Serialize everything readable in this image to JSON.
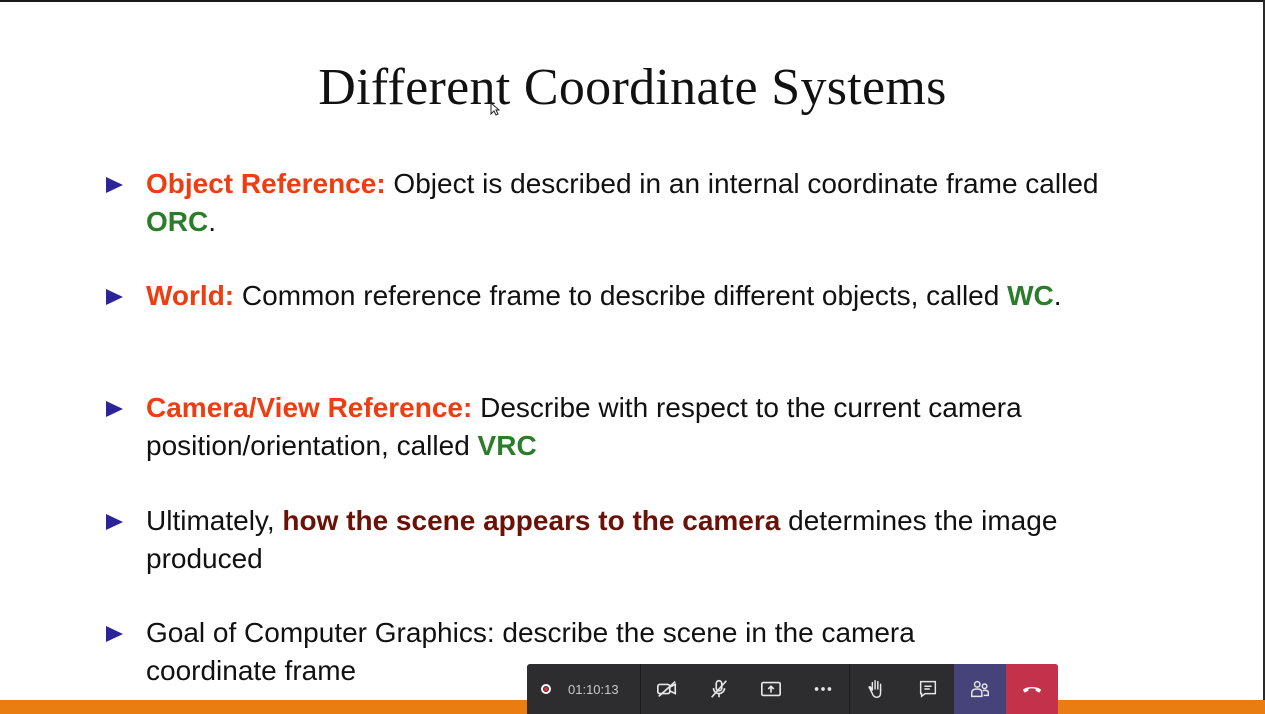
{
  "slide": {
    "title": "Different Coordinate Systems",
    "bullets": [
      {
        "keyword": "Object Reference:",
        "text": " Object is described in an internal coordinate frame called ",
        "acronym": "ORC",
        "tail": "."
      },
      {
        "keyword": "World:",
        "text": " Common reference frame to describe different objects, called ",
        "acronym": "WC",
        "tail": "."
      },
      {
        "keyword": "Camera/View Reference:",
        "text": " Describe with respect to the current camera position/orientation, called ",
        "acronym": "VRC",
        "tail": ""
      },
      {
        "lead": "Ultimately, ",
        "highlight": "how the scene appears to the camera",
        "text": " determines the image produced"
      },
      {
        "text": "Goal of Computer Graphics: describe the scene in the camera coordinate frame"
      }
    ]
  },
  "meeting_bar": {
    "recording_time": "01:10:13",
    "icons": [
      "record-icon",
      "camera-off-icon",
      "mic-off-icon",
      "share-screen-icon",
      "more-icon",
      "raise-hand-icon",
      "chat-icon",
      "participants-icon",
      "leave-call-icon"
    ],
    "colors": {
      "bar": "#2d2d30",
      "participants_active": "#45437a",
      "leave": "#c4314b",
      "record": "#e5334b"
    }
  },
  "colors": {
    "keyword": "#ee3d11",
    "acronym": "#2b7d2b",
    "highlight": "#6a1208",
    "bullet_marker": "#2c2398",
    "bottom_stripe": "#ea7d12"
  }
}
